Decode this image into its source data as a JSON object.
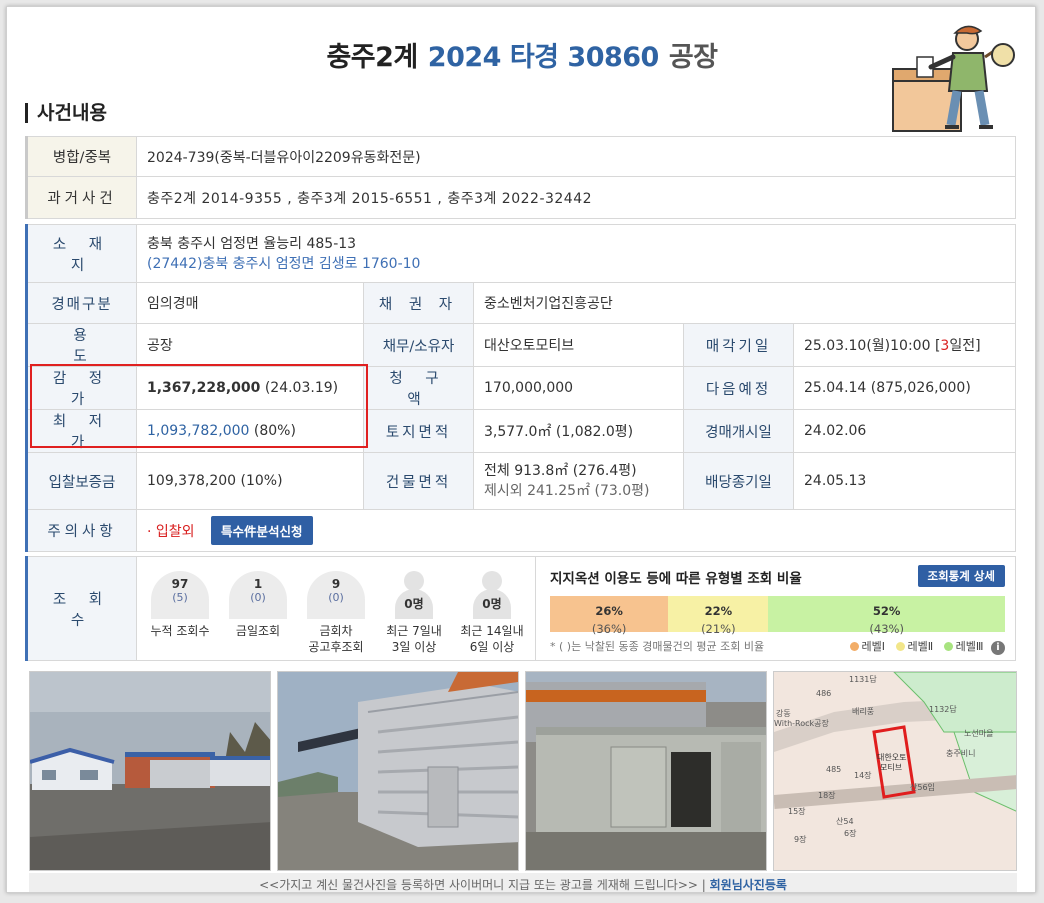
{
  "header": {
    "court": "충주2계",
    "case_no": "2024 타경 30860",
    "kind": "공장",
    "section_title": "사건내용"
  },
  "merge": {
    "label": "병합/중복",
    "value": "2024-739(중복-더블유아이2209유동화전문)"
  },
  "past": {
    "label": "과거사건",
    "value": "충주2계 2014-9355  , 충주3계 2015-6551  , 충주3계 2022-32442"
  },
  "location": {
    "label": "소 재 지",
    "address": "충북 충주시 엄정면 율능리 485-13",
    "road_address": "(27442)충북 충주시  엄정면 김생로  1760-10"
  },
  "auction_type": {
    "label": "경매구분",
    "value": "임의경매"
  },
  "creditor": {
    "label": "채 권 자",
    "value": "중소벤처기업진흥공단"
  },
  "usage": {
    "label": "용 도",
    "value": "공장"
  },
  "debtor": {
    "label": "채무/소유자",
    "value": "대산오토모티브"
  },
  "sale_date": {
    "label": "매각기일",
    "value_prefix": "25.03.10(월)10:00 [",
    "days": "3",
    "value_suffix": "일전]"
  },
  "appraisal": {
    "label": "감 정 가",
    "amount": "1,367,228,000",
    "date": " (24.03.19)"
  },
  "claim": {
    "label": "청 구 액",
    "value": "170,000,000"
  },
  "next_schedule": {
    "label": "다음예정",
    "value": "25.04.14 (875,026,000)"
  },
  "minimum": {
    "label": "최 저 가",
    "amount": "1,093,782,000",
    "pct": " (80%)"
  },
  "land_area": {
    "label": "토지면적",
    "value": "3,577.0㎡ (1,082.0평)"
  },
  "start_date": {
    "label": "경매개시일",
    "value": "24.02.06"
  },
  "deposit": {
    "label": "입찰보증금",
    "value": "109,378,200 (10%)"
  },
  "building_area": {
    "label": "건물면적",
    "total": "전체 913.8㎡ (276.4평)",
    "excluded": "제시외 241.25㎡ (73.0평)"
  },
  "dividend_end": {
    "label": "배당종기일",
    "value": "24.05.13"
  },
  "caution": {
    "label": "주의사항",
    "item": "· 입찰외",
    "button": "특수件분석신청"
  },
  "views": {
    "label": "조 회 수",
    "stats": [
      {
        "num": "97",
        "sub": "(5)",
        "cap1": "누적 조회수",
        "cap2": ""
      },
      {
        "num": "1",
        "sub": "(0)",
        "cap1": "금일조회",
        "cap2": ""
      },
      {
        "num": "9",
        "sub": "(0)",
        "cap1": "금회차",
        "cap2": "공고후조회"
      },
      {
        "num": "0명",
        "sub": "",
        "cap1": "최근 7일내",
        "cap2": "3일 이상"
      },
      {
        "num": "0명",
        "sub": "",
        "cap1": "최근 14일내",
        "cap2": "6일 이상"
      }
    ]
  },
  "ratio": {
    "title": "지지옥션 이용도 등에 따른 유형별 조회 비율",
    "button": "조회통계 상세",
    "segments": [
      {
        "pct": "26%",
        "avg": "(36%)",
        "value": 26,
        "color": "#f7c38f"
      },
      {
        "pct": "22%",
        "avg": "(21%)",
        "value": 22,
        "color": "#f7f1a5"
      },
      {
        "pct": "52%",
        "avg": "(43%)",
        "value": 52,
        "color": "#c8f2a3"
      }
    ],
    "note": "* ( )는 낙찰된 동종 경매물건의 평균 조회 비율",
    "legend": [
      "레벨Ⅰ",
      "레벨Ⅱ",
      "레벨Ⅲ"
    ]
  },
  "map_labels": [
    "1131답",
    "486",
    "강동",
    "With-Rock공장",
    "배리풍",
    "대한오토",
    "모티브",
    "485",
    "14장",
    "산56임",
    "1132답",
    "노선마을",
    "충주비니",
    "18장",
    "15장",
    "산54",
    "9장",
    "6장"
  ],
  "footer": {
    "text": "<<가지고 계신 물건사진을 등록하면 사이버머니 지급 또는 광고를 게재해 드립니다>>  |",
    "link": "회원님사진등록"
  }
}
